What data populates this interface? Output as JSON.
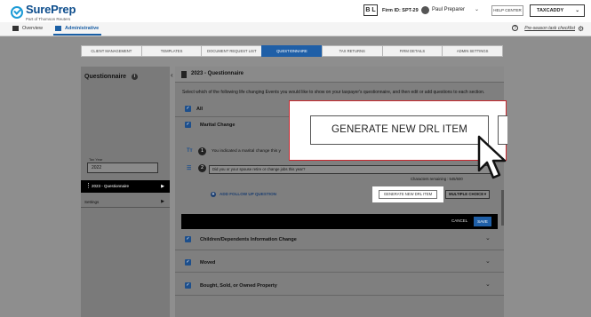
{
  "header": {
    "logo_name": "SurePrep",
    "logo_sub": "Part of Thomson Reuters",
    "firm_badge": "B L",
    "firm_id": "Firm ID: SPT-29",
    "user_name": "Paul Preparer",
    "help_label": "HELP CENTER",
    "taxcaddy_label": "TAXCADDY"
  },
  "nav": {
    "overview": "Overview",
    "administrative": "Administrative",
    "pre_season": "Pre-season task checklist"
  },
  "tabs": [
    "CLIENT MANAGEMENT",
    "TEMPLATES",
    "DOCUMENT REQUEST LIST",
    "QUESTIONNAIRE",
    "TAX RETURNS",
    "FIRM DETAILS",
    "ADMIN SETTINGS"
  ],
  "active_tab": "QUESTIONNAIRE",
  "sidebar": {
    "title": "Questionnaire",
    "tax_year_label": "Tax Year",
    "tax_year_value": "2022",
    "selected_item": "2023 - Questionnaire",
    "settings_label": "Settings"
  },
  "main": {
    "title": "2023 - Questionnaire",
    "description": "Select which of the following life changing Events you would like to show on your taxpayer's questionnaire, and then edit or add questions to each section.",
    "all_label": "All",
    "events": [
      {
        "label": "Marital Change"
      },
      {
        "label": "Children/Dependents Information Change"
      },
      {
        "label": "Moved"
      },
      {
        "label": "Bought, Sold, or Owned Property"
      }
    ],
    "q1_number": "1",
    "q1_text": "You indicated a marital change this y",
    "q2_number": "2",
    "q2_text": "Did you or your spouse retire or change jobs this year?",
    "char_count": "Characters remaining : 545/600",
    "add_followup": "ADD FOLLOW UP QUESTION",
    "drl_small": "GENERATE NEW DRL ITEM",
    "multiple_choice": "MULTIPLE CHOICE",
    "cancel": "CANCEL",
    "save": "SAVE"
  },
  "callout": {
    "button_label": "GENERATE NEW DRL ITEM"
  },
  "colors": {
    "accent": "#1f5fa7",
    "callout_border": "#c8282f",
    "checkbox": "#1d4f8c"
  }
}
